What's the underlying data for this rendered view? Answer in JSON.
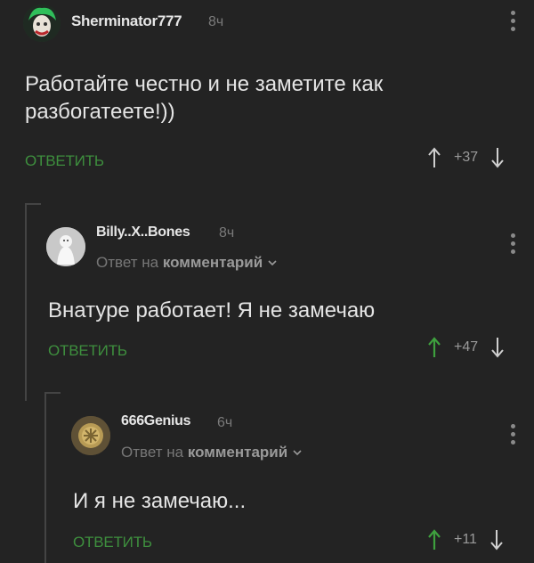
{
  "comments": [
    {
      "author": "Sherminator777",
      "time": "8ч",
      "text_lines": [
        "Работайте честно и не заметите как",
        "разбогатеете!))"
      ],
      "reply_label": "ОТВЕТИТЬ",
      "score": "+37"
    },
    {
      "author": "Billy..X..Bones",
      "time": "8ч",
      "reply_to_prefix": "Ответ на",
      "reply_to_link": "комментарий",
      "text_lines": [
        "Внатуре работает! Я не замечаю"
      ],
      "reply_label": "ОТВЕТИТЬ",
      "score": "+47"
    },
    {
      "author": "666Genius",
      "time": "6ч",
      "reply_to_prefix": "Ответ на",
      "reply_to_link": "комментарий",
      "text_lines": [
        "И я не замечаю..."
      ],
      "reply_label": "ОТВЕТИТЬ",
      "score": "+11"
    }
  ],
  "colors": {
    "background": "#232323",
    "reply_green": "#3e8f3e",
    "upvote_green": "#3ea03e",
    "muted": "#7a7a7a"
  },
  "icons": [
    "joker-avatar",
    "ghost-avatar",
    "coin-avatar",
    "kebab-menu-icon",
    "upvote-arrow-icon",
    "downvote-arrow-icon",
    "chevron-down-icon"
  ]
}
